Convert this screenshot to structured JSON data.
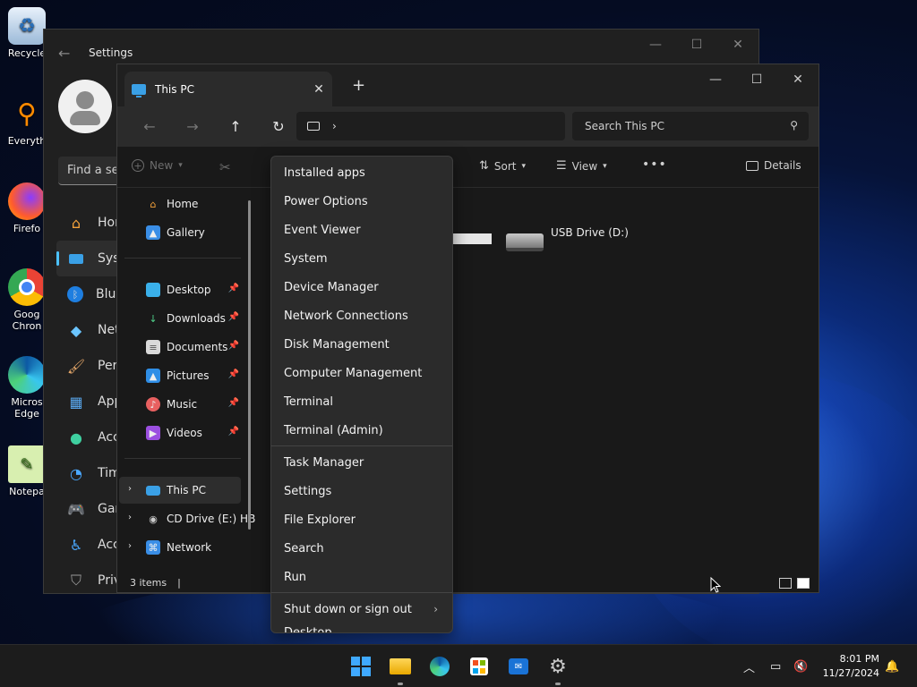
{
  "desktop": {
    "icons": [
      {
        "label": "Recycle",
        "icon": "recycle-bin-icon"
      },
      {
        "label": "Everyth",
        "icon": "everything-search-icon"
      },
      {
        "label": "Firefo",
        "icon": "firefox-icon"
      },
      {
        "label": "Goog… Chron",
        "line1": "Goog",
        "line2": "Chron",
        "icon": "chrome-icon"
      },
      {
        "label": "Micros Edge",
        "line1": "Micros",
        "line2": "Edge",
        "icon": "edge-icon"
      },
      {
        "label": "Notepa",
        "icon": "notepad-icon"
      }
    ]
  },
  "settings": {
    "title": "Settings",
    "search_placeholder": "Find a se",
    "nav": [
      {
        "label": "Hor",
        "icon": "home-icon"
      },
      {
        "label": "Syst",
        "icon": "system-icon"
      },
      {
        "label": "Blue",
        "icon": "bluetooth-icon"
      },
      {
        "label": "Net",
        "icon": "network-icon"
      },
      {
        "label": "Pers",
        "icon": "personalization-icon"
      },
      {
        "label": "App",
        "icon": "apps-icon"
      },
      {
        "label": "Acc",
        "icon": "accounts-icon"
      },
      {
        "label": "Tim",
        "icon": "time-icon"
      },
      {
        "label": "Gan",
        "icon": "gaming-icon"
      },
      {
        "label": "Acc",
        "icon": "accessibility-icon"
      },
      {
        "label": "Priv",
        "icon": "privacy-icon"
      }
    ]
  },
  "explorer": {
    "tab_title": "This PC",
    "new_tab": "+",
    "search_placeholder": "Search This PC",
    "toolbar": {
      "new_label": "New",
      "sort_label": "Sort",
      "view_label": "View",
      "more_label": "•••",
      "details_label": "Details"
    },
    "sidebar": {
      "home": "Home",
      "gallery": "Gallery",
      "desktop": "Desktop",
      "downloads": "Downloads",
      "documents": "Documents",
      "pictures": "Pictures",
      "music": "Music",
      "videos": "Videos",
      "this_pc": "This PC",
      "cd_drive": "CD Drive (E:) HB",
      "network": "Network"
    },
    "drive_usb": "USB Drive (D:)",
    "status": "3 items",
    "status_sep": "|"
  },
  "context_menu": {
    "items_group1": [
      "Installed apps",
      "Power Options",
      "Event Viewer",
      "System",
      "Device Manager",
      "Network Connections",
      "Disk Management",
      "Computer Management",
      "Terminal",
      "Terminal (Admin)"
    ],
    "items_group2": [
      "Task Manager",
      "Settings",
      "File Explorer",
      "Search",
      "Run"
    ],
    "shutdown": "Shut down or sign out",
    "desktop_partial": "Desktop"
  },
  "taskbar": {
    "time": "8:01 PM",
    "date": "11/27/2024"
  }
}
